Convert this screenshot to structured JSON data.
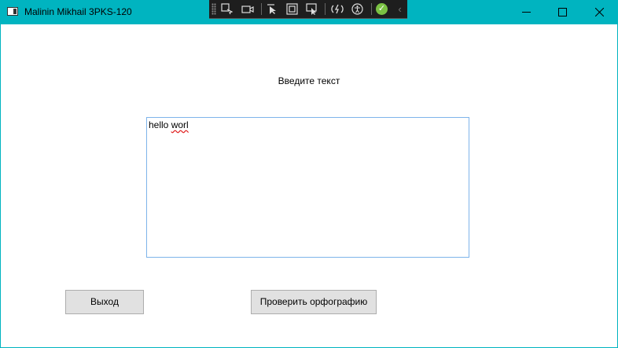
{
  "window": {
    "title": "Malinin Mikhail 3PKS-120",
    "controls": {
      "minimize": "—",
      "maximize": "☐",
      "close": "✕"
    }
  },
  "devtoolbar": {
    "icons": [
      "select-element-icon",
      "camera-icon",
      "pointer-icon",
      "layout-adorner-icon",
      "track-focus-icon",
      "hot-reload-icon",
      "accessibility-icon",
      "check-icon",
      "collapse-icon"
    ],
    "check_glyph": "✓",
    "collapse_glyph": "‹"
  },
  "content": {
    "prompt_label": "Введите текст",
    "textbox": {
      "text_prefix": "hello ",
      "misspelled_word": "worl"
    },
    "exit_button": "Выход",
    "check_button": "Проверить орфографию"
  },
  "colors": {
    "titlebar": "#00b4c0",
    "client_background": "#ffffff",
    "textbox_border": "#7eb4ea",
    "button_background": "#e1e1e1",
    "spell_error_underline": "#e02020",
    "check_badge": "#7ac143"
  }
}
